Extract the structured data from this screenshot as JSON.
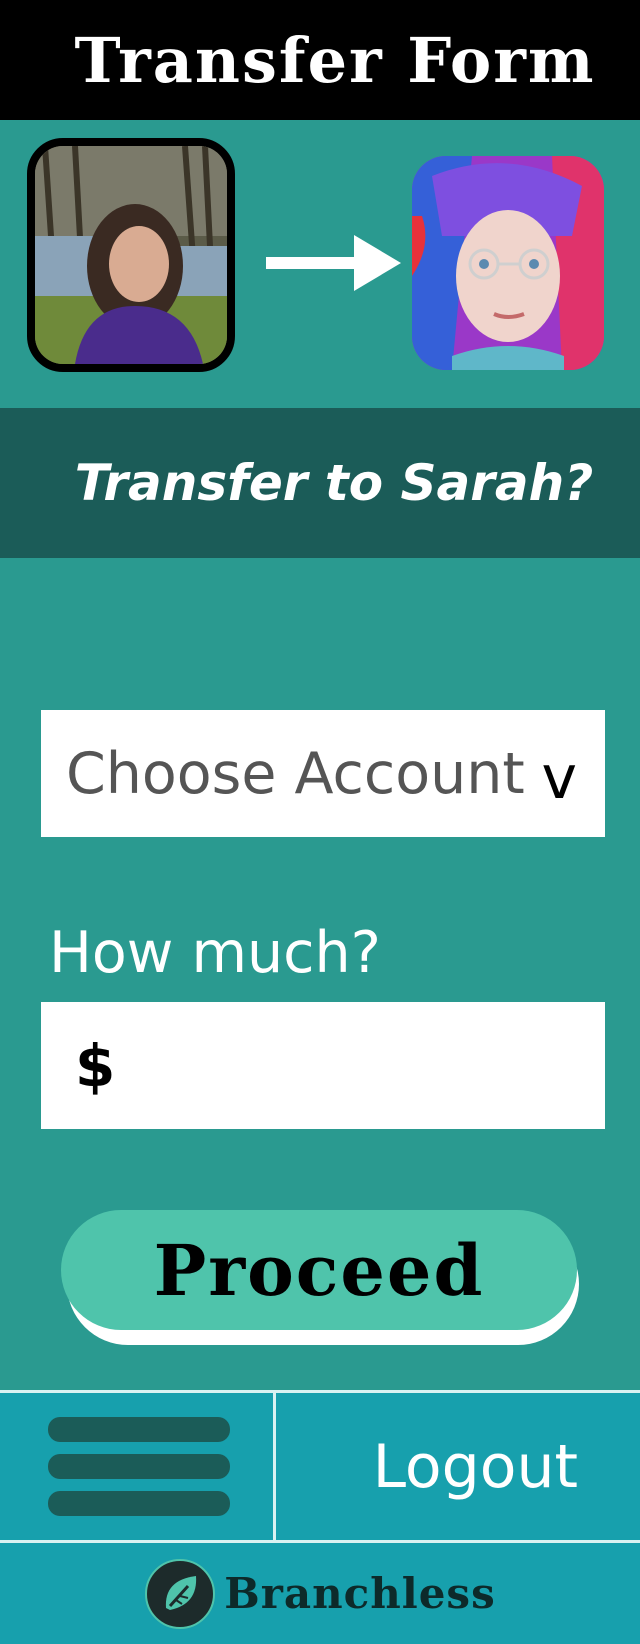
{
  "header": {
    "title": "Transfer Form"
  },
  "transfer": {
    "question": "Transfer to Sarah?"
  },
  "form": {
    "account_select": {
      "value": "Choose Account",
      "chevron": "v"
    },
    "amount": {
      "label": "How much?",
      "currency_symbol": "$",
      "value": ""
    },
    "proceed_label": "Proceed"
  },
  "nav": {
    "logout_label": "Logout"
  },
  "brand": {
    "name": "Branchless"
  },
  "colors": {
    "background": "#2a9a90",
    "header": "#000000",
    "banner": "#1b5c58",
    "button": "#4fc4ab",
    "nav": "#17a0ad"
  },
  "icons": {
    "arrow": "arrow-right-icon",
    "menu": "hamburger-menu-icon",
    "logo": "leaf-icon"
  }
}
